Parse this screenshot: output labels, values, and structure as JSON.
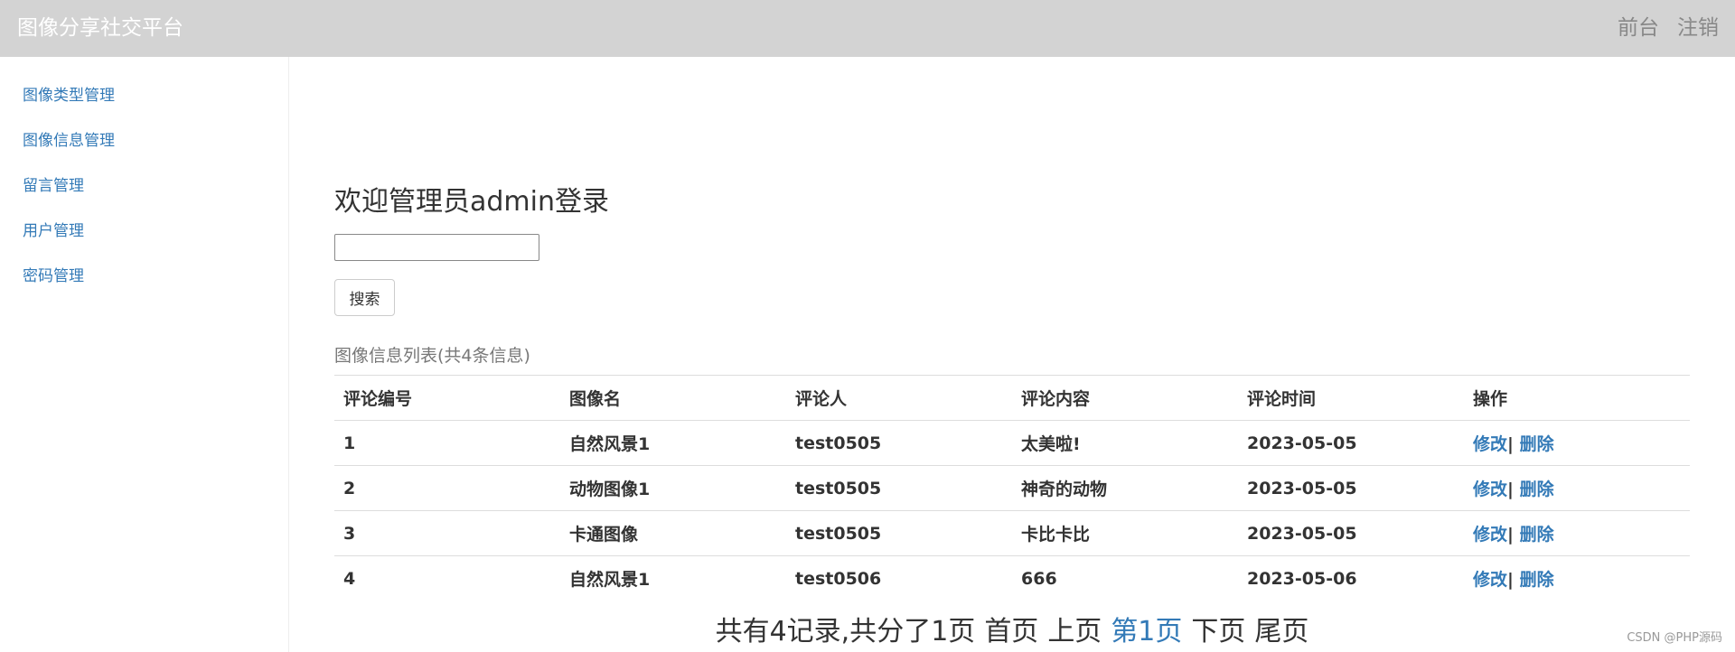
{
  "navbar": {
    "brand": "图像分享社交平台",
    "links": [
      "前台",
      "注销"
    ]
  },
  "sidebar": {
    "items": [
      {
        "label": "图像类型管理"
      },
      {
        "label": "图像信息管理"
      },
      {
        "label": "留言管理"
      },
      {
        "label": "用户管理"
      },
      {
        "label": "密码管理"
      }
    ]
  },
  "main": {
    "welcome": "欢迎管理员admin登录",
    "search": {
      "value": "",
      "button_label": "搜索"
    },
    "caption": "图像信息列表(共4条信息)",
    "table": {
      "headers": [
        "评论编号",
        "图像名",
        "评论人",
        "评论内容",
        "评论时间",
        "操作"
      ],
      "rows": [
        {
          "id": "1",
          "image": "自然风景1",
          "user": "test0505",
          "content": "太美啦!",
          "time": "2023-05-05"
        },
        {
          "id": "2",
          "image": "动物图像1",
          "user": "test0505",
          "content": "神奇的动物",
          "time": "2023-05-05"
        },
        {
          "id": "3",
          "image": "卡通图像",
          "user": "test0505",
          "content": "卡比卡比",
          "time": "2023-05-05"
        },
        {
          "id": "4",
          "image": "自然风景1",
          "user": "test0506",
          "content": "666",
          "time": "2023-05-06"
        }
      ],
      "edit_label": "修改",
      "separator": "|",
      "delete_label": "删除"
    },
    "pagination": {
      "summary": "共有4记录,共分了1页",
      "first": "首页",
      "prev": "上页",
      "current": "第1页",
      "next": "下页",
      "last": "尾页"
    }
  },
  "watermark": "CSDN @PHP源码",
  "colors": {
    "navbar_bg": "#d3d3d3",
    "link": "#337ab7",
    "text": "#333333"
  }
}
